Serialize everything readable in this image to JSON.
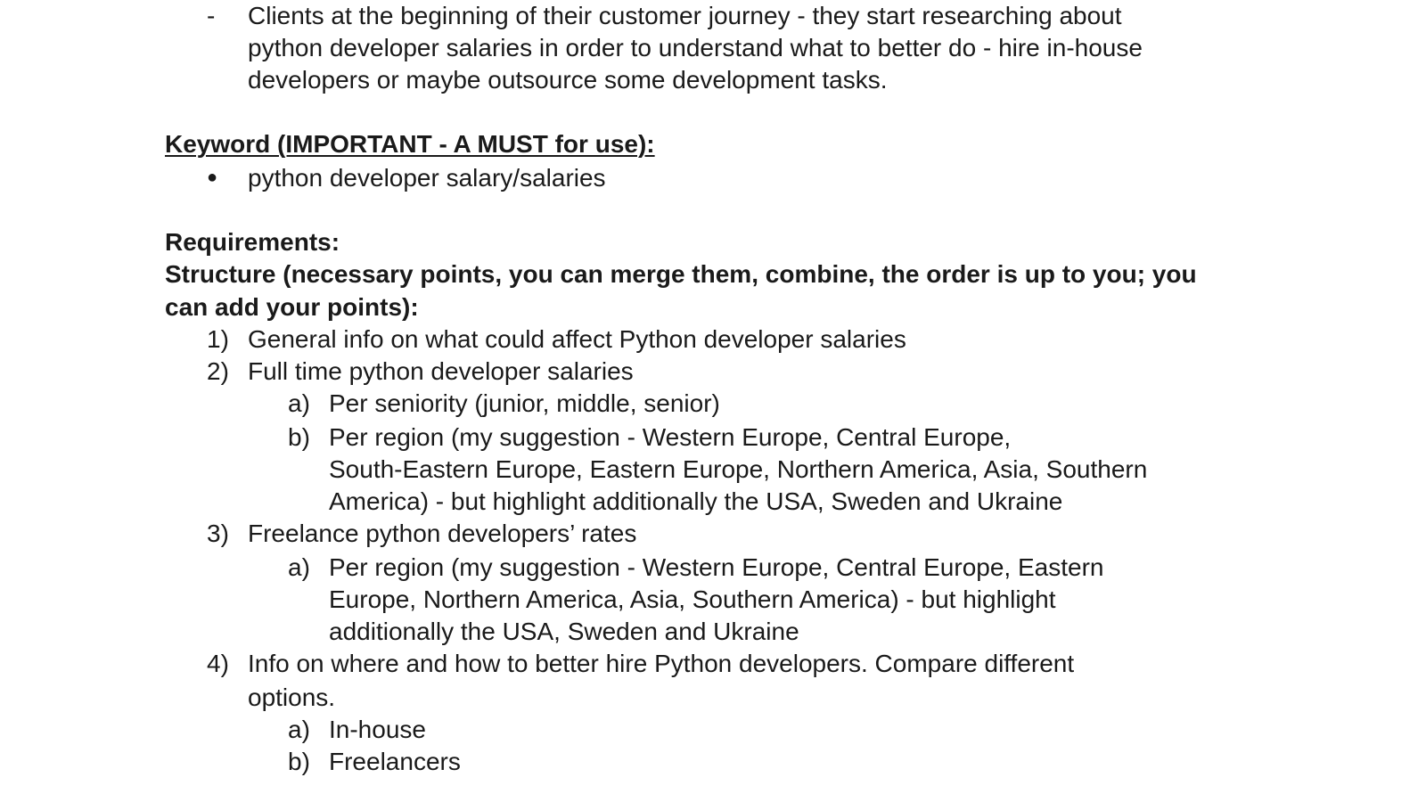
{
  "intro_bullet": {
    "marker": "-",
    "lines": [
      "Clients at the beginning of their customer journey - they start researching about",
      "python developer salaries in order to understand what to better do - hire in-house",
      "developers or maybe outsource some development tasks."
    ]
  },
  "keyword": {
    "heading": "Keyword (IMPORTANT - A MUST for use):",
    "bullet_marker": "●",
    "item": "python developer salary/salaries"
  },
  "requirements": {
    "heading": "Requirements:",
    "structure_lines": [
      "Structure (necessary points, you can merge them, combine, the order is up to you; you",
      "can add your points):"
    ],
    "items": [
      {
        "num": "1)",
        "lines": [
          "General info on what could affect Python developer salaries"
        ]
      },
      {
        "num": "2)",
        "lines": [
          "Full time python developer salaries"
        ],
        "sub": [
          {
            "num": "a)",
            "lines": [
              "Per seniority (junior, middle, senior)"
            ]
          },
          {
            "num": "b)",
            "lines": [
              "Per region (my suggestion - Western Europe, Central Europe,",
              "South-Eastern Europe, Eastern Europe, Northern America, Asia, Southern",
              "America) - but highlight additionally the USA, Sweden and Ukraine"
            ]
          }
        ]
      },
      {
        "num": "3)",
        "lines": [
          "Freelance python developers’ rates"
        ],
        "sub": [
          {
            "num": "a)",
            "lines": [
              "Per region (my suggestion - Western Europe, Central Europe, Eastern",
              "Europe, Northern America, Asia, Southern America) - but highlight",
              "additionally the USA, Sweden and Ukraine"
            ]
          }
        ]
      },
      {
        "num": "4)",
        "lines": [
          "Info on where and how to better hire Python developers. Compare different",
          "options."
        ],
        "sub": [
          {
            "num": "a)",
            "lines": [
              "In-house"
            ]
          },
          {
            "num": "b)",
            "lines": [
              "Freelancers"
            ]
          }
        ]
      }
    ]
  }
}
